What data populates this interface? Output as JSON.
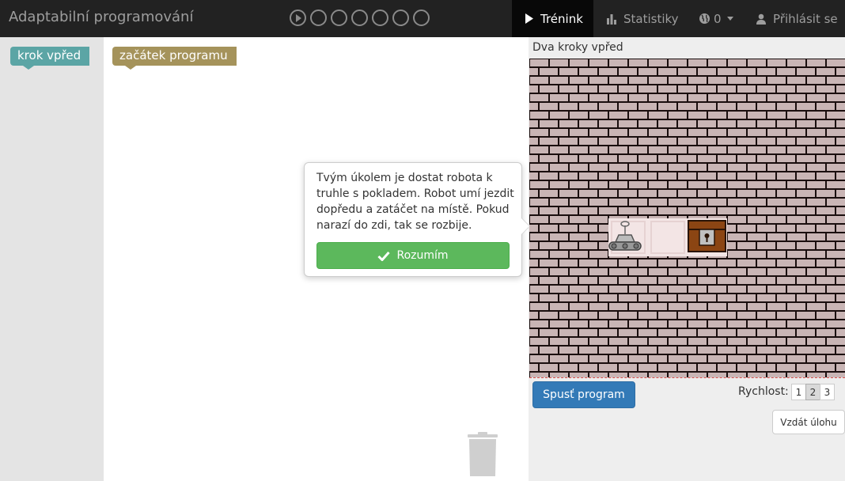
{
  "app": {
    "title": "Adaptabilní programování"
  },
  "progress": {
    "total_levels": 7,
    "current_level": 1,
    "icons": [
      "play-circle-icon",
      "circle-icon"
    ]
  },
  "nav": {
    "training": {
      "label": "Trénink",
      "icon": "play-icon",
      "active": true
    },
    "statistics": {
      "label": "Statistiky",
      "icon": "bar-chart-icon"
    },
    "points": {
      "label": "0",
      "icon": "globe-icon"
    },
    "login": {
      "label": "Přihlásit se",
      "icon": "user-icon"
    }
  },
  "blocks": {
    "toolbox": [
      {
        "label": "krok vpřed",
        "color": "#5ba5a5"
      }
    ],
    "workspace": [
      {
        "label": "začátek programu",
        "color": "#a5935b"
      }
    ]
  },
  "tooltip": {
    "text": "Tvým úkolem je dostat robota k truhle s pokladem. Robot umí jezdit dopředu a zatáčet na místě. Pokud narazí do zdi, tak se rozbije.",
    "button_label": "Rozumím",
    "button_icon": "check-icon"
  },
  "task": {
    "title": "Dva kroky vpřed",
    "world": {
      "cells": [
        "robot",
        "empty",
        "treasure"
      ],
      "wall_color": "#c9b5b5",
      "mortar_color": "#1a0e0e",
      "floor_color": "#f3e5e5",
      "treasure_color": "#8b4513"
    }
  },
  "controls": {
    "run_label": "Spusť program",
    "speed_label": "Rychlost:",
    "speed_options": [
      "1",
      "2",
      "3"
    ],
    "speed_selected": "2",
    "surrender_label": "Vzdát úlohu"
  },
  "colors": {
    "navbar": "#222222",
    "success": "#5cb85c",
    "primary": "#337ab7"
  }
}
